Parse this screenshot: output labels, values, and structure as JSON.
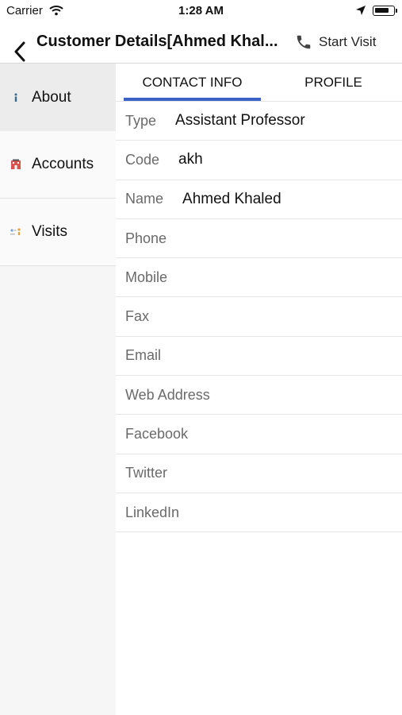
{
  "status_bar": {
    "carrier": "Carrier",
    "time": "1:28 AM",
    "battery_level": 0.8
  },
  "nav": {
    "title": "Customer Details[Ahmed Khal...",
    "start_visit_label": "Start Visit",
    "icons": {
      "back": "chevron-left-icon",
      "phone": "phone-icon"
    }
  },
  "sidebar": {
    "items": [
      {
        "label": "About",
        "icon": "info-icon",
        "active": true
      },
      {
        "label": "Accounts",
        "icon": "building-icon",
        "active": false
      },
      {
        "label": "Visits",
        "icon": "route-icon",
        "active": false
      }
    ]
  },
  "tabs": [
    {
      "label": "CONTACT INFO",
      "active": true
    },
    {
      "label": "PROFILE",
      "active": false
    }
  ],
  "contact_info": {
    "rows": [
      {
        "label": "Type",
        "value": "Assistant Professor"
      },
      {
        "label": "Code",
        "value": "akh"
      },
      {
        "label": "Name",
        "value": "Ahmed Khaled"
      },
      {
        "label": "Phone",
        "value": ""
      },
      {
        "label": "Mobile",
        "value": ""
      },
      {
        "label": "Fax",
        "value": ""
      },
      {
        "label": "Email",
        "value": ""
      },
      {
        "label": "Web Address",
        "value": ""
      },
      {
        "label": "Facebook",
        "value": ""
      },
      {
        "label": "Twitter",
        "value": ""
      },
      {
        "label": "LinkedIn",
        "value": ""
      }
    ]
  },
  "colors": {
    "accent": "#3a63c9",
    "sidebar_bg": "#f6f6f6",
    "active_item_bg": "#ececec",
    "label_gray": "#6a6a6a"
  }
}
